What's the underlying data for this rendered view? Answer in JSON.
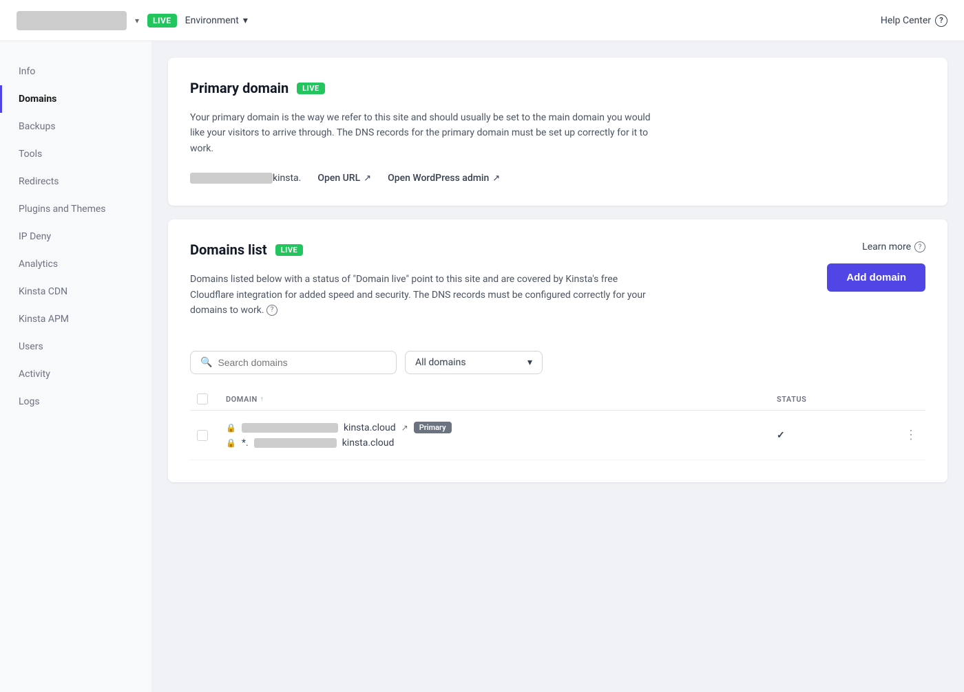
{
  "header": {
    "live_label": "LIVE",
    "env_label": "Environment",
    "help_label": "Help Center",
    "chevron": "▾"
  },
  "sidebar": {
    "items": [
      {
        "id": "info",
        "label": "Info"
      },
      {
        "id": "domains",
        "label": "Domains",
        "active": true
      },
      {
        "id": "backups",
        "label": "Backups"
      },
      {
        "id": "tools",
        "label": "Tools"
      },
      {
        "id": "redirects",
        "label": "Redirects"
      },
      {
        "id": "plugins-themes",
        "label": "Plugins and Themes"
      },
      {
        "id": "ip-deny",
        "label": "IP Deny"
      },
      {
        "id": "analytics",
        "label": "Analytics"
      },
      {
        "id": "kinsta-cdn",
        "label": "Kinsta CDN"
      },
      {
        "id": "kinsta-apm",
        "label": "Kinsta APM"
      },
      {
        "id": "users",
        "label": "Users"
      },
      {
        "id": "activity",
        "label": "Activity"
      },
      {
        "id": "logs",
        "label": "Logs"
      }
    ]
  },
  "primary_domain": {
    "title": "Primary domain",
    "live_badge": "LIVE",
    "description": "Your primary domain is the way we refer to this site and should usually be set to the main domain you would like your visitors to arrive through. The DNS records for the primary domain must be set up correctly for it to work.",
    "domain_suffix": "kinsta.",
    "open_url_label": "Open URL",
    "open_wp_label": "Open WordPress admin"
  },
  "domains_list": {
    "title": "Domains list",
    "live_badge": "LIVE",
    "learn_more_label": "Learn more",
    "add_domain_label": "Add domain",
    "description": "Domains listed below with a status of \"Domain live\" point to this site and are covered by Kinsta's free Cloudflare integration for added speed and security. The DNS records must be configured correctly for your domains to work.",
    "search_placeholder": "Search domains",
    "filter_label": "All domains",
    "table": {
      "col_domain": "DOMAIN",
      "col_status": "STATUS",
      "sort_icon": "↑",
      "rows": [
        {
          "domain_suffix": "kinsta.cloud",
          "domain_wildcard_suffix": "kinsta.cloud",
          "primary_badge": "Primary",
          "has_check": true
        }
      ]
    }
  }
}
